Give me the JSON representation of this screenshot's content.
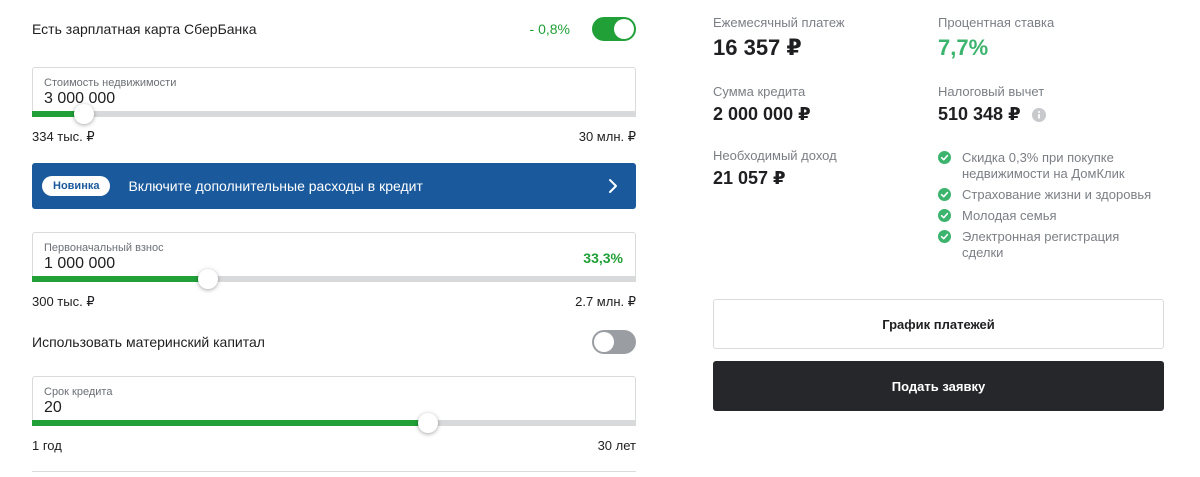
{
  "salary_card": {
    "label": "Есть зарплатная карта СберБанка",
    "discount": "- 0,8%",
    "enabled": true
  },
  "property_cost": {
    "label": "Стоимость недвижимости",
    "value": "3 000 000",
    "min_label": "334 тыс. ₽",
    "max_label": "30 млн. ₽",
    "fill_percent": 8.6
  },
  "promo": {
    "badge": "Новинка",
    "text": "Включите дополнительные расходы в кредит"
  },
  "down_payment": {
    "label": "Первоначальный взнос",
    "value": "1 000 000",
    "percent": "33,3%",
    "min_label": "300 тыс. ₽",
    "max_label": "2.7 млн. ₽",
    "fill_percent": 29.2
  },
  "maternity_capital": {
    "label": "Использовать материнский капитал",
    "enabled": false
  },
  "loan_term": {
    "label": "Срок кредита",
    "value": "20",
    "min_label": "1 год",
    "max_label": "30 лет",
    "fill_percent": 65.5
  },
  "summary": {
    "monthly_payment_label": "Ежемесячный платеж",
    "monthly_payment_value": "16 357 ₽",
    "interest_rate_label": "Процентная ставка",
    "interest_rate_value": "7,7%",
    "loan_amount_label": "Сумма кредита",
    "loan_amount_value": "2 000 000 ₽",
    "tax_deduction_label": "Налоговый вычет",
    "tax_deduction_value": "510 348 ₽",
    "required_income_label": "Необходимый доход",
    "required_income_value": "21 057 ₽"
  },
  "benefits": [
    "Скидка 0,3% при покупке недвижимости на ДомКлик",
    "Страхование жизни и здоровья",
    "Молодая семья",
    "Электронная регистрация сделки"
  ],
  "buttons": {
    "schedule": "График платежей",
    "apply": "Подать заявку"
  },
  "colors": {
    "accent_green": "#21a038",
    "rate_green": "#3cb46e",
    "promo_blue": "#1a5a9c",
    "dark_button": "#26272b"
  }
}
